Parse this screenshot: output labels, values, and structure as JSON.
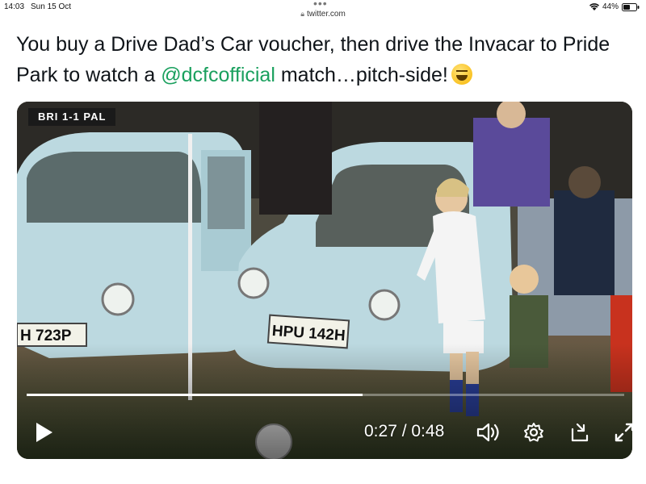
{
  "status_bar": {
    "time": "14:03",
    "date": "Sun 15 Oct",
    "battery": "44%",
    "url": "twitter.com"
  },
  "tweet": {
    "text_before": "You buy a Drive Dad’s Car voucher, then drive the Invacar to Pride Park to watch a ",
    "mention": "@dcfcofficial",
    "text_after": " match…pitch-side!",
    "emoji": "grinning-squinting-face"
  },
  "video": {
    "score_badge": "BRI 1-1 PAL",
    "number_plate_left": "H 723P",
    "number_plate_right": "HPU 142H",
    "current_time": "0:27",
    "duration": "0:48",
    "time_readout": "0:27 / 0:48",
    "progress_fraction": 0.5625
  },
  "colors": {
    "mention": "#1aa05e",
    "car": "#bcd9e0"
  }
}
